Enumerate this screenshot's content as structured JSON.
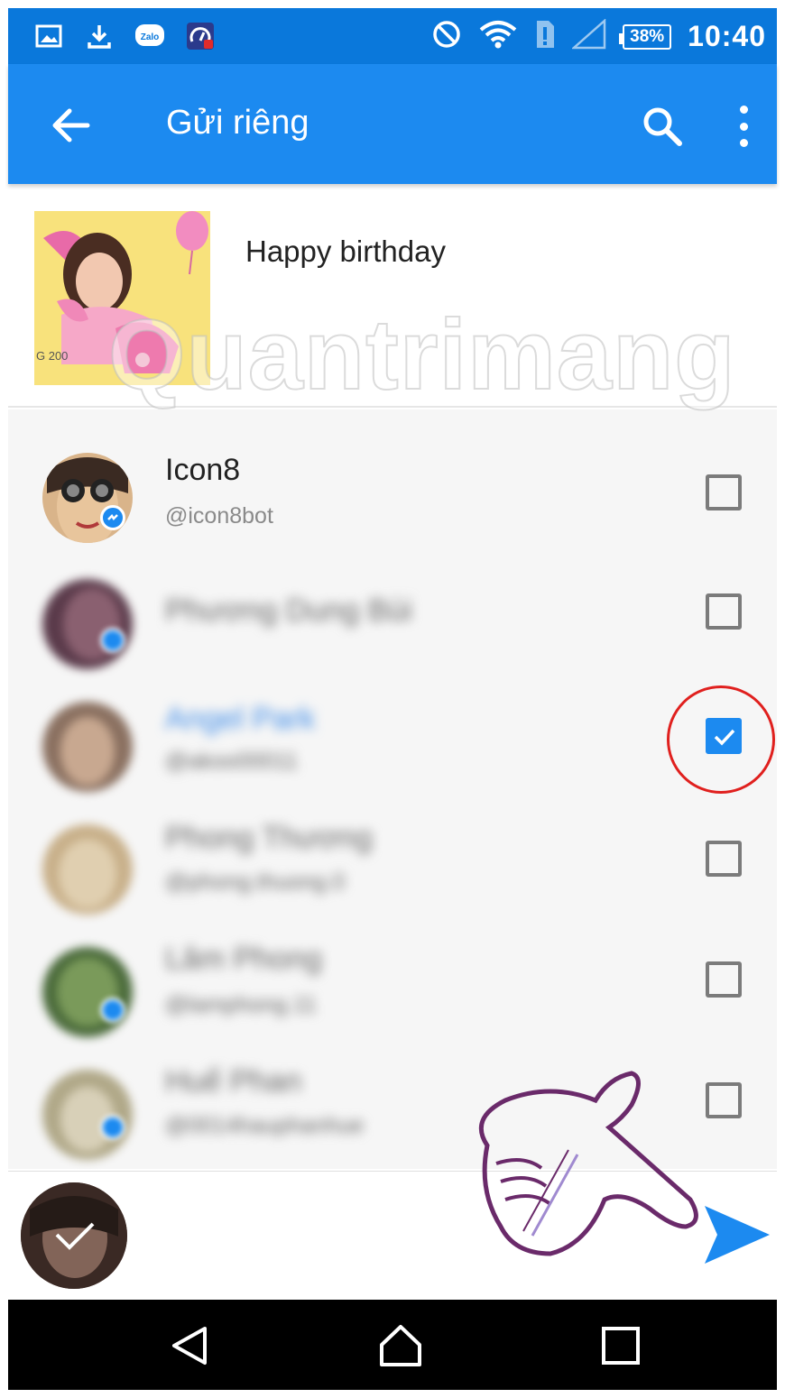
{
  "status_bar": {
    "icons": [
      "image-icon",
      "download-icon",
      "zalo-icon",
      "speed-icon",
      "no-disturb-icon",
      "wifi-icon",
      "sim-icon",
      "signal-icon"
    ],
    "battery": "38%",
    "time": "10:40"
  },
  "app_bar": {
    "title": "Gửi riêng",
    "icons": [
      "back-arrow-icon",
      "search-icon",
      "more-vert-icon"
    ]
  },
  "shared_item": {
    "title": "Happy birthday"
  },
  "contacts": [
    {
      "name": "Icon8",
      "handle": "@icon8bot",
      "checked": false,
      "blurred": false
    },
    {
      "name": "Phương Dung Bùi",
      "handle": "",
      "checked": false,
      "blurred": true
    },
    {
      "name": "Angel Park",
      "handle": "@akoo00011",
      "checked": true,
      "blurred": true
    },
    {
      "name": "Phong Thương",
      "handle": "@phong.thuong.0",
      "checked": false,
      "blurred": true
    },
    {
      "name": "Lâm Phong",
      "handle": "@lamphong.11",
      "checked": false,
      "blurred": true
    },
    {
      "name": "Huế Phan",
      "handle": "@0014hauphanhue",
      "checked": false,
      "blurred": true
    }
  ],
  "send": {
    "icon": "send-icon"
  },
  "watermark": "Quantrimang",
  "colors": {
    "accent": "#1c8af0",
    "status_bar": "#0a78db",
    "annotation": "#e0201e"
  },
  "nav_bar": {
    "icons": [
      "back-triangle-icon",
      "home-icon",
      "recents-icon"
    ]
  }
}
